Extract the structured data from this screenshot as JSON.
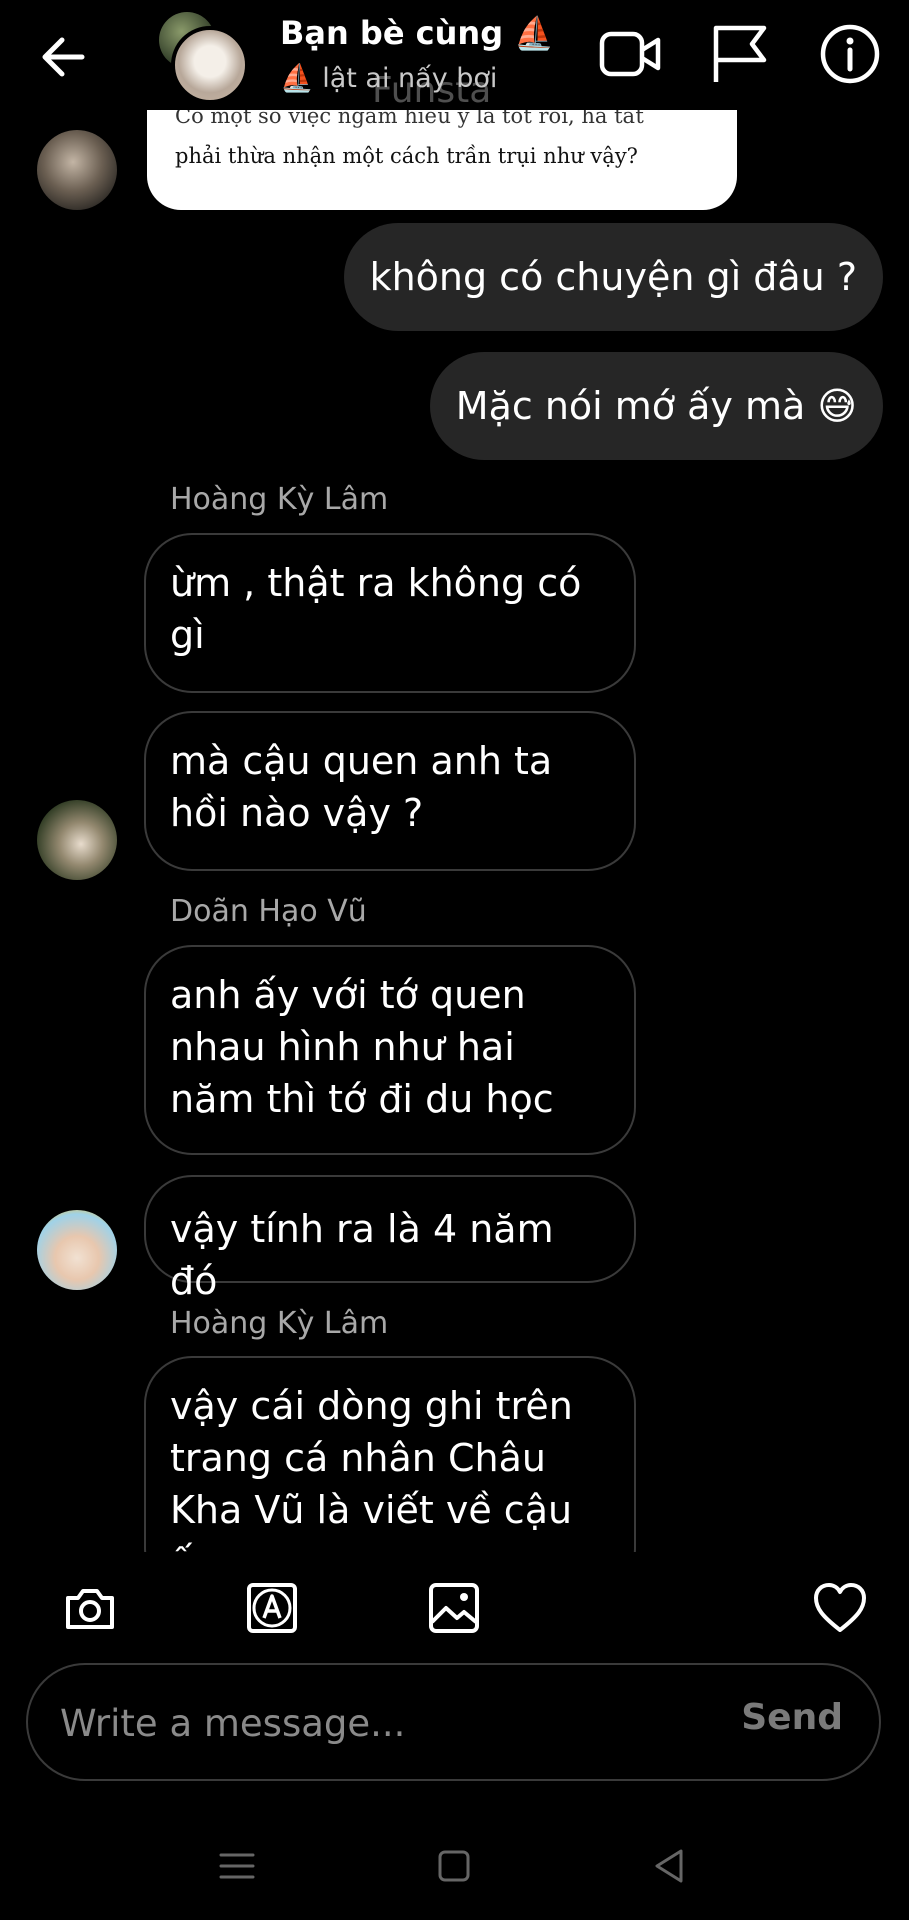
{
  "header": {
    "title": "Bạn bè cùng ⛵",
    "subtitle": "⛵ lật ai nấy bơi",
    "watermark": "Funsta"
  },
  "quoted_image": {
    "line1": "Có một số việc ngầm hiểu ý là tốt rồi, há tất",
    "line2": "phải thừa nhận một cách trần trụi như vậy?"
  },
  "messages": {
    "out1": "không có chuyện gì đâu ?",
    "out2": "Mặc nói mớ ấy mà 😅",
    "sender1": "Hoàng Kỳ Lâm",
    "in1": "ừm , thật ra không có gì",
    "in2": "mà cậu quen anh ta hồi nào vậy ?",
    "sender2": "Doãn Hạo Vũ",
    "in3": "anh ấy với tớ quen nhau hình như hai năm thì tớ đi du học",
    "in4": "vậy tính ra là 4 năm đó",
    "sender3": "Hoàng Kỳ Lâm",
    "in5": "vậy cái dòng ghi trên trang cá nhân Châu Kha Vũ  là viết  về cậu ấy"
  },
  "composer": {
    "placeholder": "Write a message...",
    "send_label": "Send"
  },
  "icons": {
    "back": "arrow-left-icon",
    "video": "video-camera-icon",
    "flag": "flag-icon",
    "info": "info-icon",
    "camera": "camera-icon",
    "sticker": "text-sticker-icon",
    "gallery": "image-icon",
    "like": "heart-icon"
  }
}
